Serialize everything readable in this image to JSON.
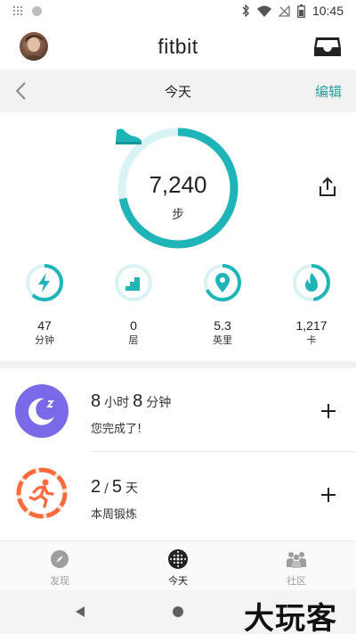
{
  "status_bar": {
    "time": "10:45"
  },
  "header": {
    "title": "fitbit"
  },
  "date_bar": {
    "title": "今天",
    "edit_label": "编辑"
  },
  "steps": {
    "value": "7,240",
    "unit": "步",
    "progress": 0.72
  },
  "stats": [
    {
      "value": "47",
      "label": "分钟",
      "progress": 0.62,
      "icon": "lightning-icon"
    },
    {
      "value": "0",
      "label": "层",
      "progress": 0.0,
      "icon": "stairs-icon"
    },
    {
      "value": "5.3",
      "label": "英里",
      "progress": 0.68,
      "icon": "location-pin-icon"
    },
    {
      "value": "1,217",
      "label": "卡",
      "progress": 0.48,
      "icon": "flame-icon"
    }
  ],
  "sleep": {
    "hours": "8",
    "hours_unit": "小时",
    "minutes": "8",
    "minutes_unit": "分钟",
    "subtitle": "您完成了!"
  },
  "exercise": {
    "done": "2",
    "separator": "/",
    "goal": "5",
    "unit": "天",
    "subtitle": "本周锻炼",
    "progress": 0.4
  },
  "bottom_nav": [
    {
      "label": "发现",
      "active": false
    },
    {
      "label": "今天",
      "active": true
    },
    {
      "label": "社区",
      "active": false
    }
  ],
  "watermark": "大玩客",
  "colors": {
    "teal": "#1fb5b8",
    "teal_light": "#d9f2f3",
    "accent_text": "#2a9d9f",
    "sleep_purple": "#7b6ae8",
    "exercise_orange": "#ff6a3d"
  }
}
